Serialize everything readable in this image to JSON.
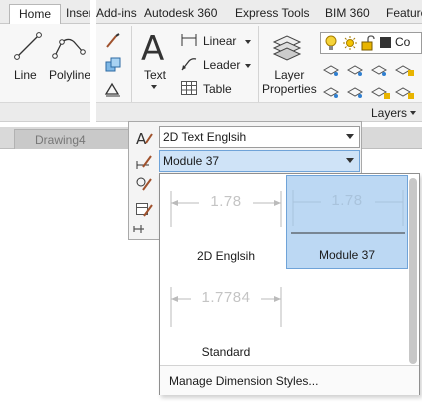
{
  "ribbon": {
    "tabs": [
      "Home",
      "Insert",
      "Add-ins",
      "Autodesk 360",
      "Express Tools",
      "BIM 360",
      "Feature"
    ],
    "draw": {
      "line_label": "Line",
      "polyline_label": "Polyline"
    },
    "annotation": {
      "text_label": "Text",
      "linear_label": "Linear",
      "leader_label": "Leader",
      "table_label": "Table"
    },
    "layers": {
      "layer_properties_label": "Layer\nProperties",
      "layer_combo_text": "Co",
      "panel_title": "Layers"
    }
  },
  "file_tab": {
    "label": "Drawing4"
  },
  "annotation_panel": {
    "text_style_value": "2D Text Englsih",
    "dim_style_value": "Module 37"
  },
  "dim_style_gallery": {
    "items": [
      {
        "name": "2D Englsih",
        "dim_text": "1.78",
        "selected": false
      },
      {
        "name": "Module 37",
        "dim_text": "1.78",
        "selected": true
      },
      {
        "name": "Standard",
        "dim_text": "1.7784",
        "selected": false
      }
    ],
    "manage_label": "Manage Dimension Styles..."
  },
  "colors": {
    "selection_fill": "#bcd8f3",
    "selection_border": "#6fa3d8",
    "layer_bulb": "#e8b400",
    "layer_sun": "#e0a000"
  }
}
